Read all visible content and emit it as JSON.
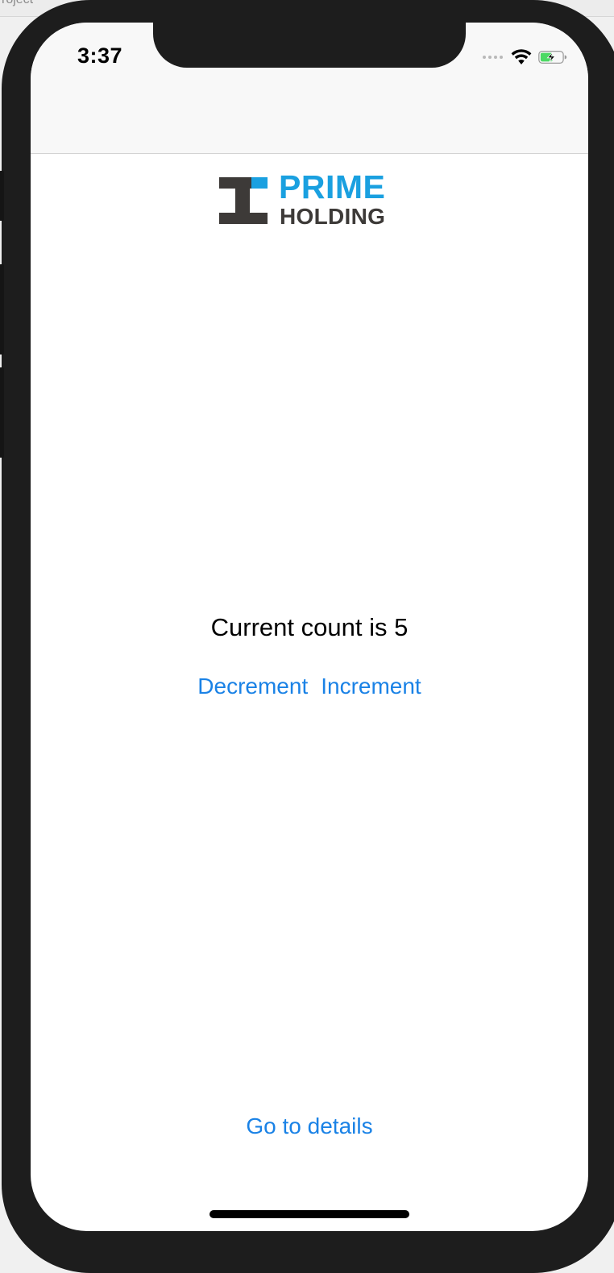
{
  "host": {
    "partial_title": "roject"
  },
  "status_bar": {
    "time": "3:37",
    "icons": [
      "signal-dots-icon",
      "wifi-icon",
      "battery-charging-icon"
    ],
    "battery_color": "#4cd964"
  },
  "logo": {
    "line1": "PRIME",
    "line2": "HOLDING",
    "brand_blue": "#1aa0e0",
    "brand_dark": "#3d3a38"
  },
  "counter": {
    "label": "Current count is 5",
    "value": 5,
    "decrement_label": "Decrement",
    "increment_label": "Increment"
  },
  "footer": {
    "details_label": "Go to details"
  },
  "colors": {
    "link": "#1a82e6",
    "navbar_bg": "#f8f8f8",
    "device_frame": "#1d1d1d"
  }
}
